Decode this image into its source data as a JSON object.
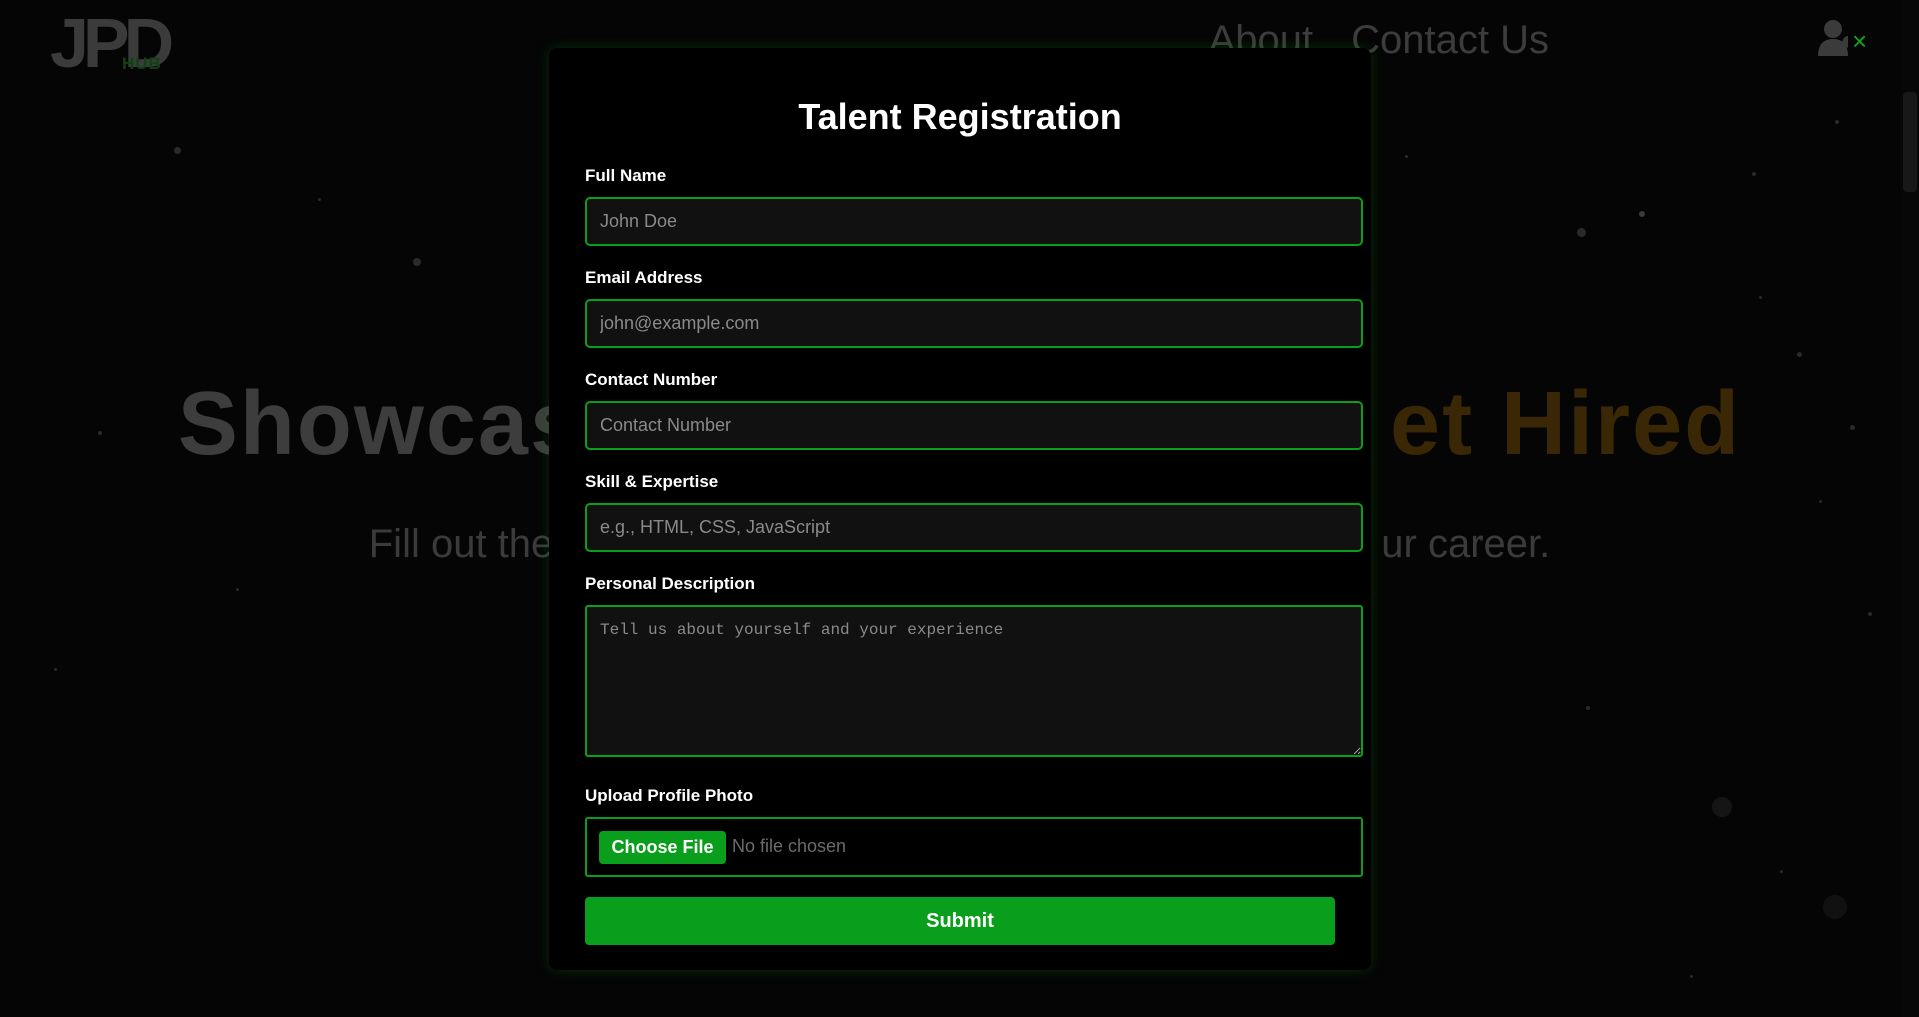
{
  "header": {
    "logo_text": "JPD",
    "logo_sub": "HUB",
    "nav_about": "About",
    "nav_contact": "Contact Us",
    "user_icon": "user-icon"
  },
  "hero": {
    "title_part1": "Showcas",
    "title_part2": "et Hired",
    "subtitle_part1": "Fill out the",
    "subtitle_part2": "ur career."
  },
  "modal": {
    "close_symbol": "×",
    "title": "Talent Registration",
    "full_name_label": "Full Name",
    "full_name_placeholder": "John Doe",
    "email_label": "Email Address",
    "email_placeholder": "john@example.com",
    "contact_label": "Contact Number",
    "contact_placeholder": "Contact Number",
    "skill_label": "Skill & Expertise",
    "skill_placeholder": "e.g., HTML, CSS, JavaScript",
    "description_label": "Personal Description",
    "description_placeholder": "Tell us about yourself and your experience",
    "photo_label": "Upload Profile Photo",
    "choose_file_label": "Choose File",
    "file_status": "No file chosen",
    "submit_label": "Submit"
  },
  "colors": {
    "accent_green": "#099e1b",
    "border_green": "#0c9e18",
    "hero_orange_dim": "#3a2705"
  }
}
